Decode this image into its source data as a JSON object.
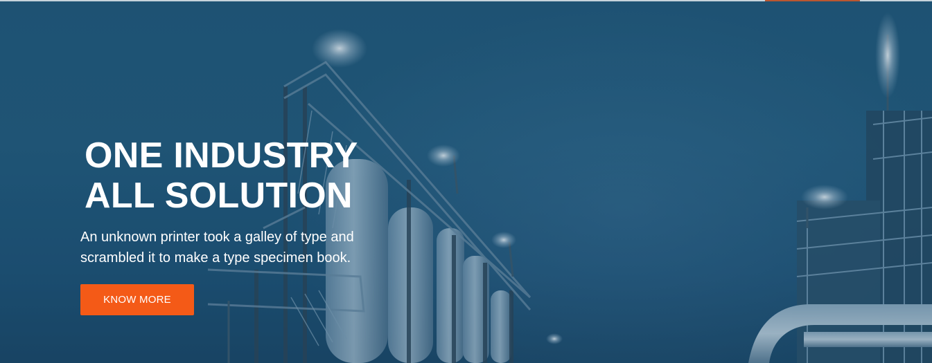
{
  "hero": {
    "headline_line1": "ONE INDUSTRY",
    "headline_line2": "ALL SOLUTION",
    "subtext_line1": "An unknown printer took a galley of type and",
    "subtext_line2": "scrambled it to make a type specimen book.",
    "cta_label": "KNOW MORE"
  },
  "colors": {
    "accent": "#f45a17",
    "overlay": "#1f5373",
    "text": "#ffffff"
  }
}
